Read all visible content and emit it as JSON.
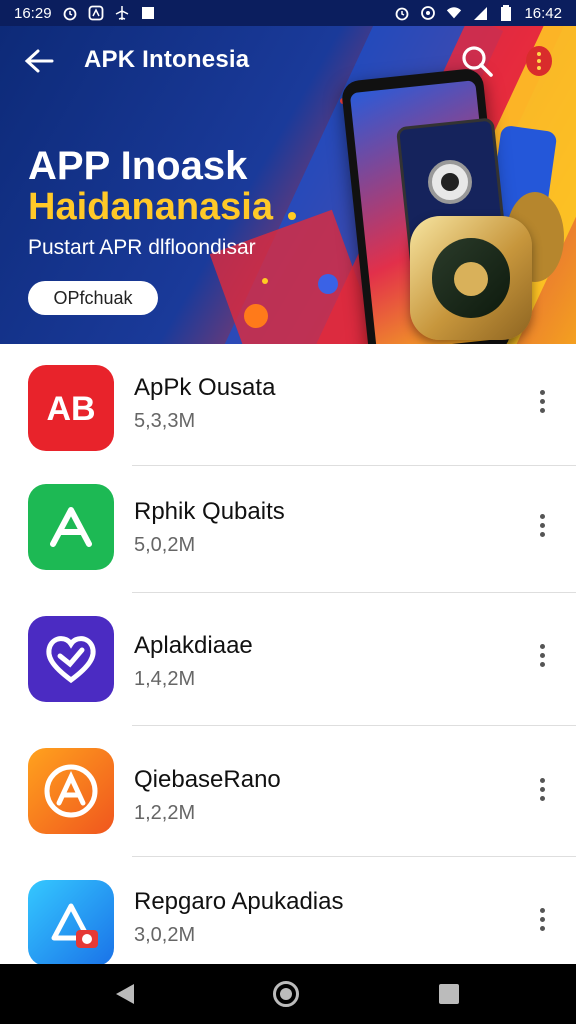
{
  "status_bar": {
    "time_left": "16:29",
    "time_right": "16:42"
  },
  "header": {
    "title": "APK Intonesia",
    "back_icon": "arrow-left-icon",
    "search_icon": "search-icon",
    "more_icon": "more-vert-icon"
  },
  "hero": {
    "title": "APP Inoask",
    "subtitle": "Haidananasia",
    "description": "Pustart APR dlfloondisar",
    "button_label": "OPfchuak"
  },
  "apps": [
    {
      "name": "ApPk Ousata",
      "size": "5,3,3M",
      "icon_label": "AB",
      "icon_color": "#e8232b"
    },
    {
      "name": "Rphik Qubaits",
      "size": "5,0,2M",
      "icon_label": "A",
      "icon_color": "#1db954"
    },
    {
      "name": "Aplakdiaae",
      "size": "1,4,2M",
      "icon_label": "heart-link",
      "icon_color": "#4b2bc2"
    },
    {
      "name": "QiebaseRano",
      "size": "1,2,2M",
      "icon_label": "A",
      "icon_color": "#f5781e"
    },
    {
      "name": "Repgaro Apukadias",
      "size": "3,0,2M",
      "icon_label": "triangle-camera",
      "icon_color": "#1aa3f0"
    }
  ],
  "colors": {
    "status_bar": "#0b1e5e",
    "accent_yellow": "#ffc928"
  }
}
